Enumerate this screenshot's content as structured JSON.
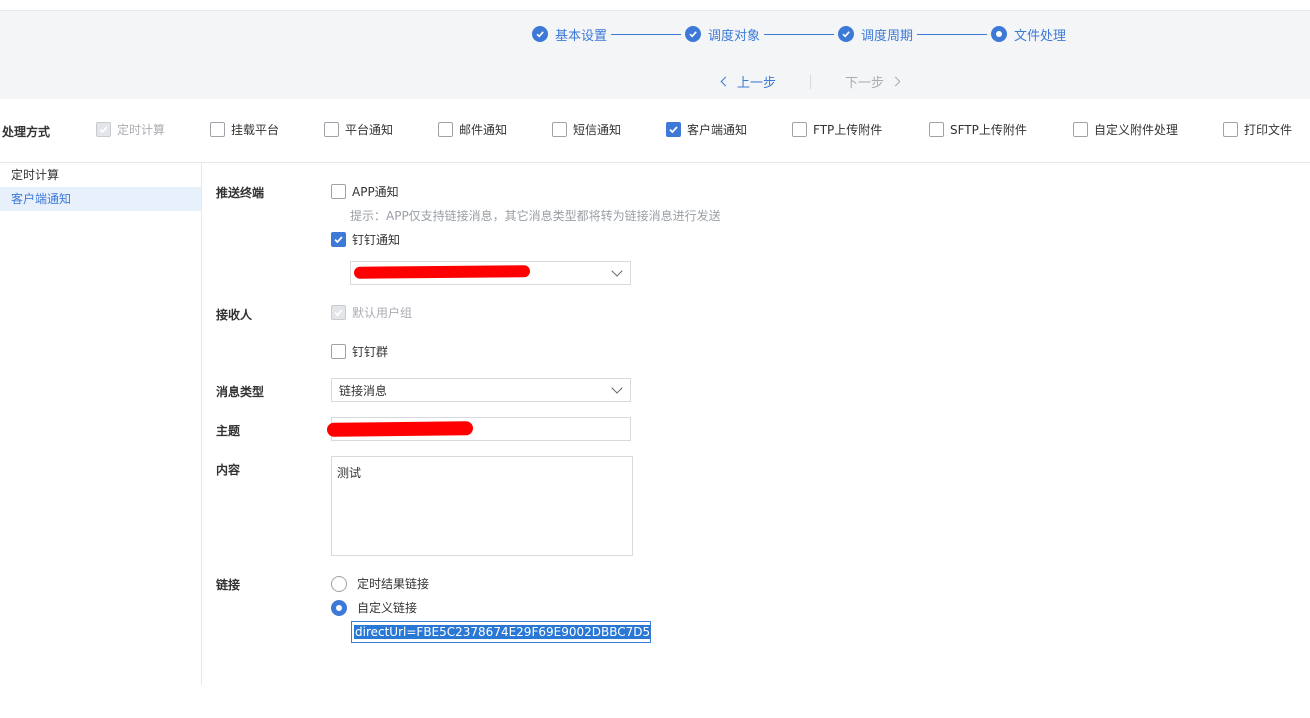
{
  "steps": [
    {
      "label": "基本设置",
      "state": "done"
    },
    {
      "label": "调度对象",
      "state": "done"
    },
    {
      "label": "调度周期",
      "state": "done"
    },
    {
      "label": "文件处理",
      "state": "current"
    }
  ],
  "pager": {
    "prev": "上一步",
    "next": "下一步"
  },
  "methods": {
    "label": "处理方式",
    "items": [
      {
        "label": "定时计算",
        "checked": true,
        "disabled": true
      },
      {
        "label": "挂载平台",
        "checked": false
      },
      {
        "label": "平台通知",
        "checked": false
      },
      {
        "label": "邮件通知",
        "checked": false
      },
      {
        "label": "短信通知",
        "checked": false
      },
      {
        "label": "客户端通知",
        "checked": true
      },
      {
        "label": "FTP上传附件",
        "checked": false
      },
      {
        "label": "SFTP上传附件",
        "checked": false
      },
      {
        "label": "自定义附件处理",
        "checked": false
      },
      {
        "label": "打印文件",
        "checked": false
      }
    ]
  },
  "sidebar": {
    "items": [
      {
        "label": "定时计算",
        "active": false
      },
      {
        "label": "客户端通知",
        "active": true
      }
    ]
  },
  "form": {
    "push_terminal": {
      "label": "推送终端",
      "app_label": "APP通知",
      "hint": "提示：APP仅支持链接消息，其它消息类型都将转为链接消息进行发送",
      "dingtalk_label": "钉钉通知"
    },
    "receiver": {
      "label": "接收人",
      "default_group": "默认用户组",
      "dingtalk_group": "钉钉群"
    },
    "msg_type": {
      "label": "消息类型",
      "value": "链接消息"
    },
    "subject": {
      "label": "主题"
    },
    "content": {
      "label": "内容",
      "value": "测试"
    },
    "link": {
      "label": "链接",
      "option1": "定时结果链接",
      "option2": "自定义链接",
      "selected": "自定义链接",
      "value": "directUrl=FBE5C2378674E29F69E9002DBBC7D553"
    }
  },
  "colors": {
    "accent": "#3d7ad8",
    "redaction": "#ff0000"
  },
  "icons": {
    "check": "check-icon",
    "chevron": "chevron-down-icon"
  }
}
